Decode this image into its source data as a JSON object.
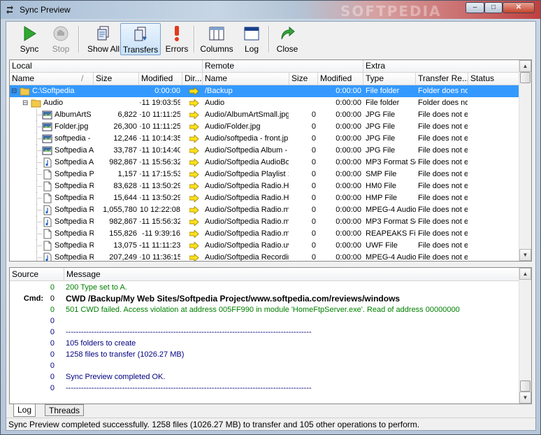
{
  "window": {
    "title": "Sync Preview",
    "watermark": "SOFTPEDIA",
    "minimize": "–",
    "maximize": "□",
    "close": "✕"
  },
  "toolbar": {
    "sync": "Sync",
    "stop": "Stop",
    "show_all": "Show All",
    "transfers": "Transfers",
    "errors": "Errors",
    "columns": "Columns",
    "log": "Log",
    "close": "Close"
  },
  "grid": {
    "group_local": "Local",
    "group_remote": "Remote",
    "group_extra": "Extra",
    "col_name": "Name",
    "col_size": "Size",
    "col_modified": "Modified",
    "col_dir": "Dir...",
    "col_rname": "Name",
    "col_rsize": "Size",
    "col_rmodified": "Modified",
    "col_type": "Type",
    "col_transfer": "Transfer Re...",
    "col_status": "Status",
    "sort_indicator": "/",
    "rows": [
      {
        "name": "C:\\Softpedia",
        "size": "",
        "modified": "0:00:00",
        "rname": "/Backup",
        "rsize": "",
        "rmod": "0:00:00",
        "type": "File folder",
        "transfer": "Folder does no",
        "icon": "folder",
        "level": 0
      },
      {
        "name": "Audio",
        "size": "",
        "modified": "·11 19:03:59",
        "rname": "Audio",
        "rsize": "",
        "rmod": "0:00:00",
        "type": "File folder",
        "transfer": "Folder does no",
        "icon": "folder",
        "level": 1
      },
      {
        "name": "AlbumArtS",
        "size": "6,822",
        "modified": "·10 11:11:25",
        "rname": "Audio/AlbumArtSmall.jpg",
        "rsize": "0",
        "rmod": "0:00:00",
        "type": "JPG File",
        "transfer": "File does not e:",
        "icon": "image",
        "level": 2
      },
      {
        "name": "Folder.jpg",
        "size": "26,300",
        "modified": "·10 11:11:25",
        "rname": "Audio/Folder.jpg",
        "rsize": "0",
        "rmod": "0:00:00",
        "type": "JPG File",
        "transfer": "File does not e:",
        "icon": "image",
        "level": 2
      },
      {
        "name": "softpedia -",
        "size": "12,246",
        "modified": "·11 10:14:35",
        "rname": "Audio/softpedia - front.jp",
        "rsize": "0",
        "rmod": "0:00:00",
        "type": "JPG File",
        "transfer": "File does not e:",
        "icon": "image",
        "level": 2
      },
      {
        "name": "Softpedia A",
        "size": "33,787",
        "modified": "·11 10:14:40",
        "rname": "Audio/Softpedia Album - :",
        "rsize": "0",
        "rmod": "0:00:00",
        "type": "JPG File",
        "transfer": "File does not e:",
        "icon": "image",
        "level": 2
      },
      {
        "name": "Softpedia A",
        "size": "982,867",
        "modified": "·11 15:56:32",
        "rname": "Audio/Softpedia AudioBo",
        "rsize": "0",
        "rmod": "0:00:00",
        "type": "MP3 Format So",
        "transfer": "File does not e:",
        "icon": "audio",
        "level": 2
      },
      {
        "name": "Softpedia P",
        "size": "1,157",
        "modified": "·11 17:15:53",
        "rname": "Audio/Softpedia Playlist 1",
        "rsize": "0",
        "rmod": "0:00:00",
        "type": "SMP File",
        "transfer": "File does not e:",
        "icon": "file",
        "level": 2
      },
      {
        "name": "Softpedia R",
        "size": "83,628",
        "modified": "·11 13:50:29",
        "rname": "Audio/Softpedia Radio.HM",
        "rsize": "0",
        "rmod": "0:00:00",
        "type": "HM0 File",
        "transfer": "File does not e:",
        "icon": "file",
        "level": 2
      },
      {
        "name": "Softpedia R",
        "size": "15,644",
        "modified": "·11 13:50:29",
        "rname": "Audio/Softpedia Radio.HM",
        "rsize": "0",
        "rmod": "0:00:00",
        "type": "HMP File",
        "transfer": "File does not e:",
        "icon": "file",
        "level": 2
      },
      {
        "name": "Softpedia R",
        "size": "1,055,780",
        "modified": "10 12:22:08",
        "rname": "Audio/Softpedia Radio.m4",
        "rsize": "0",
        "rmod": "0:00:00",
        "type": "MPEG-4 Audio",
        "transfer": "File does not e:",
        "icon": "audio",
        "level": 2
      },
      {
        "name": "Softpedia R",
        "size": "982,867",
        "modified": "·11 15:56:32",
        "rname": "Audio/Softpedia Radio.mp",
        "rsize": "0",
        "rmod": "0:00:00",
        "type": "MP3 Format So",
        "transfer": "File does not e:",
        "icon": "audio",
        "level": 2
      },
      {
        "name": "Softpedia R",
        "size": "155,826",
        "modified": "-11 9:39:16",
        "rname": "Audio/Softpedia Radio.mp",
        "rsize": "0",
        "rmod": "0:00:00",
        "type": "REAPEAKS File",
        "transfer": "File does not e:",
        "icon": "file",
        "level": 2
      },
      {
        "name": "Softpedia R",
        "size": "13,075",
        "modified": "-11 11:11:23",
        "rname": "Audio/Softpedia Radio.uv",
        "rsize": "0",
        "rmod": "0:00:00",
        "type": "UWF File",
        "transfer": "File does not e:",
        "icon": "file",
        "level": 2
      },
      {
        "name": "Softpedia R",
        "size": "207,249",
        "modified": "·10 11:36:15",
        "rname": "Audio/Softpedia Recordir",
        "rsize": "0",
        "rmod": "0:00:00",
        "type": "MPEG-4 Audio",
        "transfer": "File does not e:",
        "icon": "audio",
        "level": 2
      }
    ]
  },
  "log": {
    "col_source": "Source",
    "col_message": "Message",
    "rows": [
      {
        "source": "",
        "num": "0",
        "msg": "200 Type set to A.",
        "color": "#008000",
        "bold": false
      },
      {
        "source": "Cmd:",
        "num": "0",
        "msg": "CWD /Backup/My Web Sites/Softpedia Project/www.softpedia.com/reviews/windows",
        "color": "#000000",
        "bold": true
      },
      {
        "source": "",
        "num": "0",
        "msg": "501 CWD failed. Access violation at address 005FF990 in module 'HomeFtpServer.exe'. Read of address 00000000",
        "color": "#008000",
        "bold": false
      },
      {
        "source": "",
        "num": "0",
        "msg": "",
        "color": "#000080",
        "bold": false
      },
      {
        "source": "",
        "num": "0",
        "msg": "------------------------------------------------------------------------------------------------",
        "color": "#000080",
        "bold": false
      },
      {
        "source": "",
        "num": "0",
        "msg": "105 folders to create",
        "color": "#000080",
        "bold": false
      },
      {
        "source": "",
        "num": "0",
        "msg": "1258 files to transfer (1026.27 MB)",
        "color": "#000080",
        "bold": false
      },
      {
        "source": "",
        "num": "0",
        "msg": "",
        "color": "#000080",
        "bold": false
      },
      {
        "source": "",
        "num": "0",
        "msg": "Sync Preview completed OK.",
        "color": "#000080",
        "bold": false
      },
      {
        "source": "",
        "num": "0",
        "msg": "------------------------------------------------------------------------------------------------",
        "color": "#000080",
        "bold": false
      }
    ]
  },
  "tabs": {
    "log": "Log",
    "threads": "Threads"
  },
  "status": {
    "text": "Sync Preview completed successfully. 1258 files (1026.27 MB) to transfer and 105 other operations to perform."
  },
  "colors": {
    "selection": "#3399ff",
    "log_green": "#008000",
    "log_navy": "#000080"
  }
}
